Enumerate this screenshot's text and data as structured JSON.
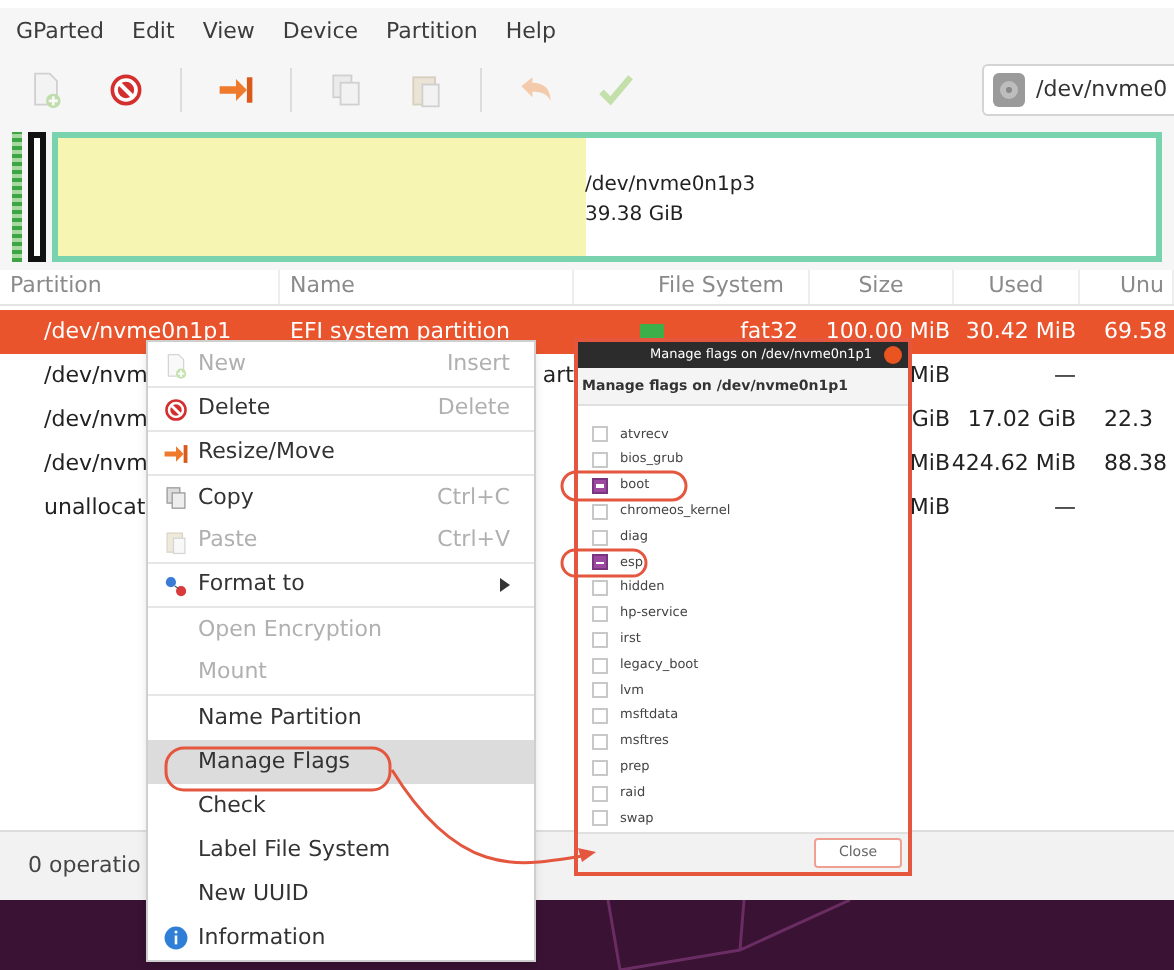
{
  "menu_bar": [
    "GParted",
    "Edit",
    "View",
    "Device",
    "Partition",
    "Help"
  ],
  "toolbar": [
    {
      "kind": "new",
      "disabled": true
    },
    {
      "kind": "delete",
      "disabled": false
    },
    {
      "kind": "resize",
      "disabled": false
    },
    {
      "kind": "copy",
      "disabled": true
    },
    {
      "kind": "paste",
      "disabled": true
    },
    {
      "kind": "undo",
      "disabled": true
    },
    {
      "kind": "apply",
      "disabled": true
    }
  ],
  "device_selector": {
    "value": "/dev/nvme0"
  },
  "disk_graph": {
    "partitions": [
      {
        "kind": "efi"
      },
      {
        "kind": "reserved"
      },
      {
        "kind": "data",
        "label": "/dev/nvme0n1p3",
        "size": "39.38 GiB",
        "level": 0.48
      }
    ]
  },
  "table": {
    "columns": [
      "Partition",
      "Name",
      "File System",
      "Size",
      "Used",
      "Unu"
    ],
    "rows": [
      {
        "selected": true,
        "partition": "/dev/nvme0n1p1",
        "name": "EFI system partition",
        "color": "#3cae4a",
        "file_system": "fat32",
        "size": "100.00 MiB",
        "used": "30.42 MiB",
        "unused": "69.58"
      },
      {
        "selected": false,
        "partition": "/dev/nvm",
        "name_tail": "art",
        "size": "MiB",
        "used": "—"
      },
      {
        "selected": false,
        "partition": "/dev/nvm",
        "size": "GiB",
        "used": "17.02 GiB",
        "unused": "22.3"
      },
      {
        "selected": false,
        "partition": "/dev/nvm",
        "size": "MiB",
        "used": "424.62 MiB",
        "unused": "88.38"
      },
      {
        "selected": false,
        "partition": "unallocat",
        "size": "MiB",
        "used": "—"
      }
    ]
  },
  "status_bar": {
    "text": "0 operatio"
  },
  "context_menu": {
    "items": [
      {
        "label": "New",
        "shortcut": "Insert",
        "kind": "new",
        "disabled": true,
        "selected": false,
        "separator_after": true
      },
      {
        "label": "Delete",
        "shortcut": "Delete",
        "kind": "delete",
        "disabled": false,
        "selected": false,
        "separator_after": true
      },
      {
        "label": "Resize/Move",
        "kind": "resize",
        "disabled": false,
        "selected": false,
        "separator_after": true
      },
      {
        "label": "Copy",
        "shortcut": "Ctrl+C",
        "kind": "copy",
        "disabled": false,
        "selected": false,
        "separator_after": false
      },
      {
        "label": "Paste",
        "shortcut": "Ctrl+V",
        "kind": "paste",
        "disabled": true,
        "selected": false,
        "separator_after": true
      },
      {
        "label": "Format to",
        "kind": "format",
        "submenu": true,
        "disabled": false,
        "selected": false,
        "separator_after": true
      },
      {
        "label": "Open Encryption",
        "disabled": true,
        "selected": false,
        "separator_after": false
      },
      {
        "label": "Mount",
        "disabled": true,
        "selected": false,
        "separator_after": true
      },
      {
        "label": "Name Partition",
        "disabled": false,
        "selected": false,
        "separator_after": false
      },
      {
        "label": "Manage Flags",
        "disabled": false,
        "selected": true,
        "separator_after": false
      },
      {
        "label": "Check",
        "disabled": false,
        "selected": false,
        "separator_after": false
      },
      {
        "label": "Label File System",
        "disabled": false,
        "selected": false,
        "separator_after": false
      },
      {
        "label": "New UUID",
        "disabled": false,
        "selected": false,
        "separator_after": false
      },
      {
        "label": "Information",
        "kind": "info",
        "disabled": false,
        "selected": false,
        "separator_after": false
      }
    ]
  },
  "flags_dialog": {
    "title": "Manage flags on /dev/nvme0n1p1",
    "heading": "Manage flags on /dev/nvme0n1p1",
    "flags": [
      {
        "label": "atvrecv",
        "checked": false
      },
      {
        "label": "bios_grub",
        "checked": false
      },
      {
        "label": "boot",
        "checked": true
      },
      {
        "label": "chromeos_kernel",
        "checked": false
      },
      {
        "label": "diag",
        "checked": false
      },
      {
        "label": "esp",
        "checked": true
      },
      {
        "label": "hidden",
        "checked": false
      },
      {
        "label": "hp-service",
        "checked": false
      },
      {
        "label": "irst",
        "checked": false
      },
      {
        "label": "legacy_boot",
        "checked": false
      },
      {
        "label": "lvm",
        "checked": false
      },
      {
        "label": "msftdata",
        "checked": false
      },
      {
        "label": "msftres",
        "checked": false
      },
      {
        "label": "prep",
        "checked": false
      },
      {
        "label": "raid",
        "checked": false
      },
      {
        "label": "swap",
        "checked": false
      }
    ],
    "close_button": "Close"
  }
}
